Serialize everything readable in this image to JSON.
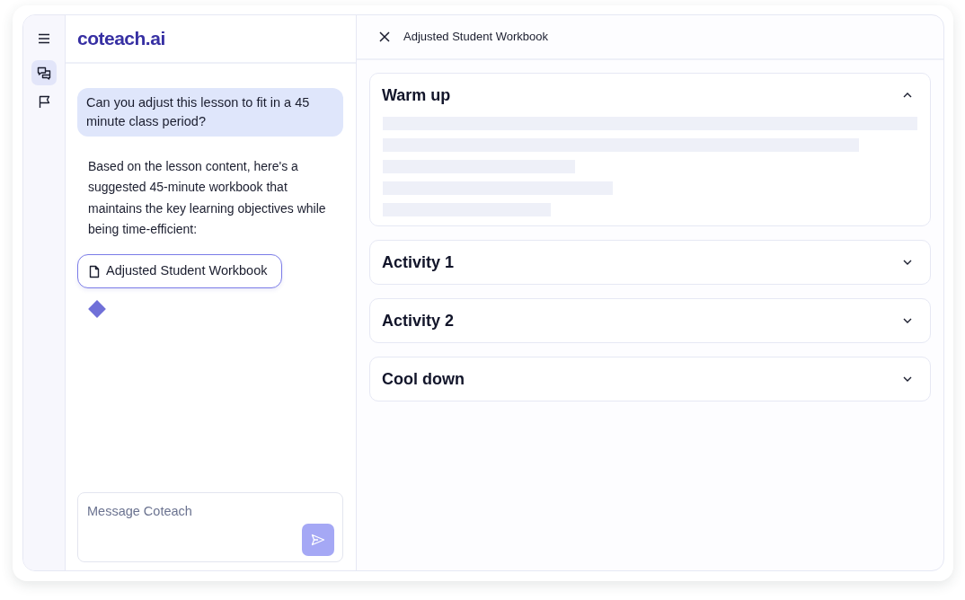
{
  "rail": {
    "items": [
      {
        "kind": "menu"
      },
      {
        "kind": "chat",
        "selected": true
      },
      {
        "kind": "flag",
        "selected": false
      }
    ]
  },
  "chat": {
    "logo": "coteach.ai",
    "messages": [
      {
        "kind": "user",
        "text": "Can you adjust this lesson to fit in a 45 minute class period?"
      },
      {
        "kind": "assistant",
        "text": "Based on the lesson content, here's a suggested 45-minute workbook that maintains the key learning objectives while being time-efficient:"
      },
      {
        "kind": "attachment",
        "text": "Adjusted Student Workbook"
      },
      {
        "kind": "thinking"
      }
    ],
    "composer": {
      "placeholder": "Message Coteach",
      "send_disabled": true
    }
  },
  "panel": {
    "title": "Adjusted Student Workbook",
    "sections": [
      {
        "title": "Warm up",
        "expanded": true
      },
      {
        "title": "Activity 1",
        "expanded": false
      },
      {
        "title": "Activity 2",
        "expanded": false
      },
      {
        "title": "Cool down",
        "expanded": false
      }
    ]
  }
}
